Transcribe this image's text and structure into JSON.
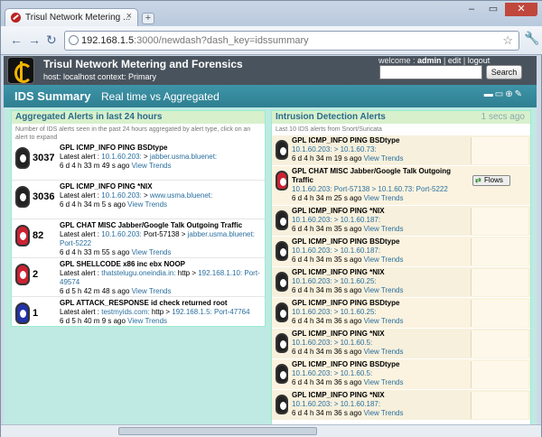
{
  "browser": {
    "tab_title": "Trisul Network Metering ...",
    "url_host": "192.168.1.5",
    "url_rest": ":3000/newdash?dash_key=idssummary"
  },
  "header": {
    "app_title": "Trisul Network Metering and Forensics",
    "host_line": "host: localhost context: Primary",
    "welcome": "welcome :",
    "user": "admin",
    "edit": "edit",
    "logout": "logout",
    "search_label": "Search"
  },
  "summary": {
    "title": "IDS Summary",
    "subtitle": "Real time vs Aggregated"
  },
  "left": {
    "title": "Aggregated Alerts in last 24 hours",
    "note": "Number of IDS alerts seen in the past 24 hours aggregated by alert type, click on an alert to expand",
    "alerts": [
      {
        "count": "3037",
        "title": "GPL ICMP_INFO PING BSDtype",
        "src": "10.1.60.203:",
        "arrow": " > ",
        "dst": "jabber.usma.bluenet:",
        "age": "6 d 4 h 33 m 49 s ago",
        "view": "View Trends",
        "color": "black"
      },
      {
        "count": "3036",
        "title": "GPL ICMP_INFO PING *NIX",
        "src": "10.1.60.203:",
        "arrow": " > ",
        "dst": "www.usma.bluenet:",
        "age": "6 d 4 h 34 m 5 s ago",
        "view": "View Trends",
        "color": "black"
      },
      {
        "count": "82",
        "title": "GPL CHAT MISC Jabber/Google Talk Outgoing Traffic",
        "src": "10.1.60.203:",
        "arrow": " Port-57138 > ",
        "dst": "jabber.usma.bluenet: Port-5222",
        "age": "6 d 4 h 33 m 55 s ago",
        "view": "View Trends",
        "color": "red"
      },
      {
        "count": "2",
        "title": "GPL SHELLCODE x86 inc ebx NOOP",
        "src": "thatstelugu.oneindia.in:",
        "arrow": " http > ",
        "dst": "192.168.1.10: Port-49574",
        "age": "6 d 5 h 42 m 48 s ago",
        "view": "View Trends",
        "color": "red"
      },
      {
        "count": "1",
        "title": "GPL ATTACK_RESPONSE id check returned root",
        "src": "testmyids.com:",
        "arrow": " http > ",
        "dst": "192.168.1.5: Port-47764",
        "age": "6 d 5 h 40 m 9 s ago",
        "view": "View Trends",
        "color": "blue"
      }
    ]
  },
  "right": {
    "title": "Intrusion Detection Alerts",
    "time": "1 secs ago",
    "note": "Last 10 IDS alerts from Snort/Suricata",
    "flows_label": "Flows",
    "alerts": [
      {
        "title": "GPL ICMP_INFO PING BSDtype",
        "line": "10.1.60.203: > 10.1.60.73:",
        "age": "6 d 4 h 34 m 19 s ago",
        "view": "View Trends",
        "color": "black"
      },
      {
        "title": "GPL CHAT MISC Jabber/Google Talk Outgoing Traffic",
        "line": "10.1.60.203: Port-57138 > 10.1.60.73: Port-5222",
        "age": "6 d 4 h 34 m 25 s ago",
        "view": "View Trends",
        "color": "red"
      },
      {
        "title": "GPL ICMP_INFO PING *NIX",
        "line": "10.1.60.203: > 10.1.60.187:",
        "age": "6 d 4 h 34 m 35 s ago",
        "view": "View Trends",
        "color": "black"
      },
      {
        "title": "GPL ICMP_INFO PING BSDtype",
        "line": "10.1.60.203: > 10.1.60.187:",
        "age": "6 d 4 h 34 m 35 s ago",
        "view": "View Trends",
        "color": "black"
      },
      {
        "title": "GPL ICMP_INFO PING *NIX",
        "line": "10.1.60.203: > 10.1.60.25:",
        "age": "6 d 4 h 34 m 36 s ago",
        "view": "View Trends",
        "color": "black"
      },
      {
        "title": "GPL ICMP_INFO PING BSDtype",
        "line": "10.1.60.203: > 10.1.60.25:",
        "age": "6 d 4 h 34 m 36 s ago",
        "view": "View Trends",
        "color": "black"
      },
      {
        "title": "GPL ICMP_INFO PING *NIX",
        "line": "10.1.60.203: > 10.1.60.5:",
        "age": "6 d 4 h 34 m 36 s ago",
        "view": "View Trends",
        "color": "black"
      },
      {
        "title": "GPL ICMP_INFO PING BSDtype",
        "line": "10.1.60.203: > 10.1.60.5:",
        "age": "6 d 4 h 34 m 36 s ago",
        "view": "View Trends",
        "color": "black"
      },
      {
        "title": "GPL ICMP_INFO PING *NIX",
        "line": "10.1.60.203: > 10.1.60.187:",
        "age": "6 d 4 h 34 m 36 s ago",
        "view": "View Trends",
        "color": "black"
      }
    ]
  }
}
